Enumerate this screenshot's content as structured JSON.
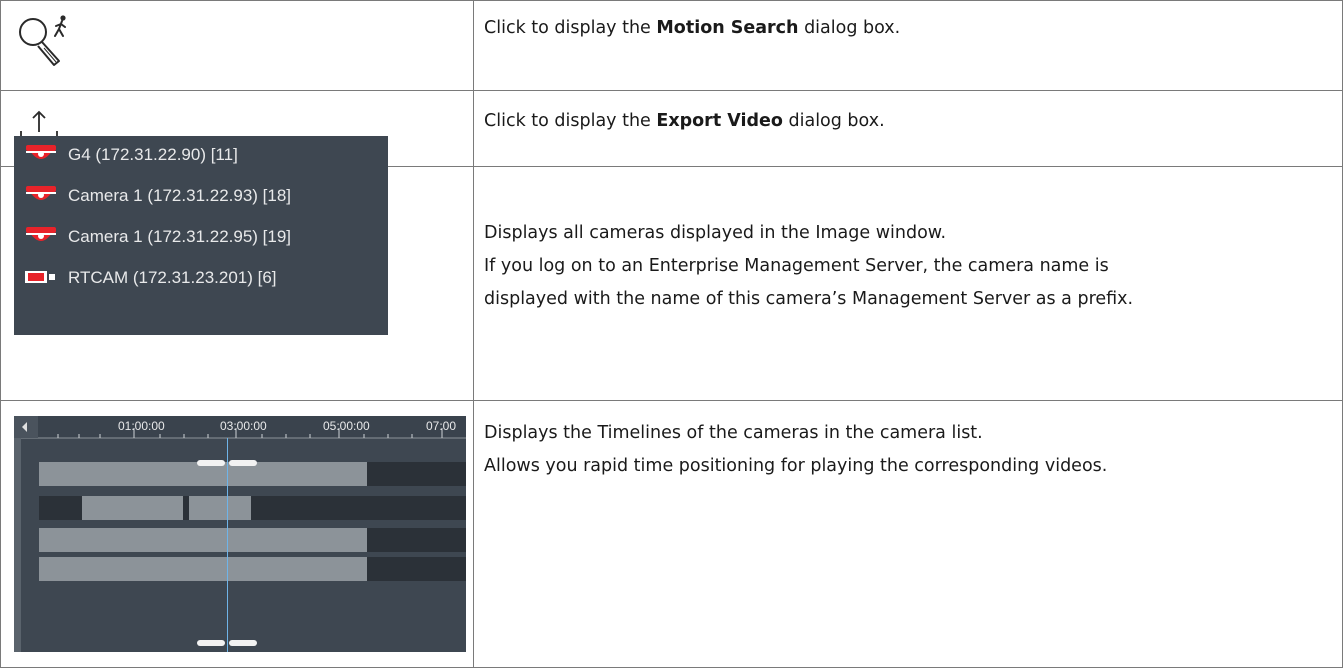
{
  "rows": [
    {
      "icon": "motion-search-icon",
      "text_before": "Click to display the ",
      "text_bold": "Motion Search",
      "text_after": " dialog box."
    },
    {
      "icon": "export-icon",
      "text_before": "Click to display the ",
      "text_bold": "Export Video",
      "text_after": " dialog box."
    },
    {
      "camera_list": [
        {
          "label": "G4 (172.31.22.90) [11]",
          "icon": "dome-camera-icon"
        },
        {
          "label": "Camera 1 (172.31.22.93) [18]",
          "icon": "dome-camera-icon"
        },
        {
          "label": "Camera 1 (172.31.22.95) [19]",
          "icon": "dome-camera-icon"
        },
        {
          "label": "RTCAM (172.31.23.201) [6]",
          "icon": "box-camera-icon"
        }
      ],
      "line1": "Displays all cameras displayed in the Image window.",
      "line2": "If you log on to an Enterprise Management Server, the camera name is",
      "line3": "displayed with the name of this camera’s Management Server as a prefix."
    },
    {
      "timeline": {
        "ticks": [
          "01:00:00",
          "03:00:00",
          "05:00:00",
          "07:00"
        ]
      },
      "line1": "Displays the Timelines of the cameras in the camera list.",
      "line2": "Allows you rapid time positioning for playing the corresponding videos."
    }
  ],
  "colors": {
    "panel_bg": "#3e4751",
    "camera_red": "#e8232a",
    "track_light": "#8c9399",
    "track_dark": "#2b3138",
    "cursor": "#6fb4e8"
  }
}
